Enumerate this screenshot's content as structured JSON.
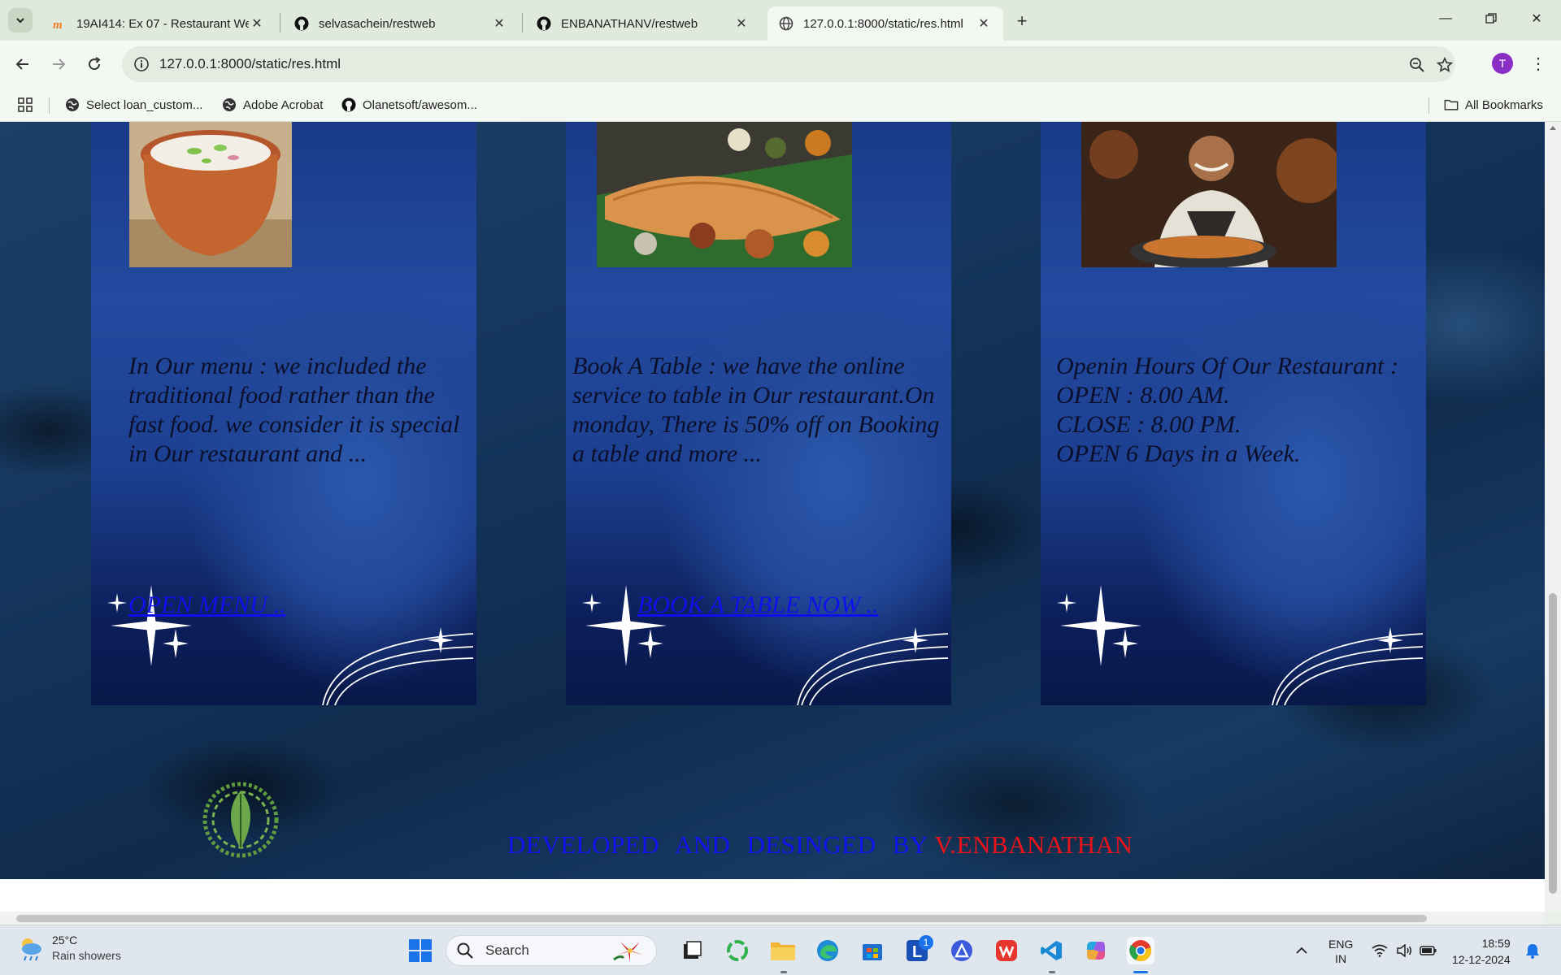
{
  "browser": {
    "tabs": [
      {
        "title": "19AI414: Ex 07 - Restaurant We",
        "active": false
      },
      {
        "title": "selvasachein/restweb",
        "active": false
      },
      {
        "title": "ENBANATHANV/restweb",
        "active": false
      },
      {
        "title": "127.0.0.1:8000/static/res.html",
        "active": true
      }
    ],
    "url": "127.0.0.1:8000/static/res.html",
    "profile_initial": "T",
    "bookmarks": [
      "Select loan_custom...",
      "Adobe Acrobat",
      "Olanetsoft/awesom..."
    ],
    "all_bookmarks": "All Bookmarks"
  },
  "page": {
    "cards": [
      {
        "description": "In Our menu : we included the traditional food rather than the fast food. we consider it is special in Our restaurant and ...",
        "link": "OPEN MENU .."
      },
      {
        "description": "Book A Table : we have the online service to table in Our restaurant.On monday, There is 50% off on Booking a table and more ...",
        "link": "BOOK A TABLE NOW .."
      },
      {
        "description_lines": [
          "Openin Hours Of Our Restaurant :",
          "OPEN : 8.00 AM.",
          "CLOSE : 8.00 PM.",
          "OPEN 6 Days in a Week."
        ]
      }
    ],
    "footer": {
      "text_blue": "DEVELOPED AND DESINGED BY",
      "text_red": "V.ENBANATHAN"
    },
    "colors": {
      "link_blue": "#1010ee",
      "footer_red": "#e8141a"
    }
  },
  "taskbar": {
    "weather_temp": "25°C",
    "weather_condition": "Rain showers",
    "search_label": "Search",
    "language": [
      "ENG",
      "IN"
    ],
    "time": "18:59",
    "date": "12-12-2024",
    "badge_count": "1"
  }
}
